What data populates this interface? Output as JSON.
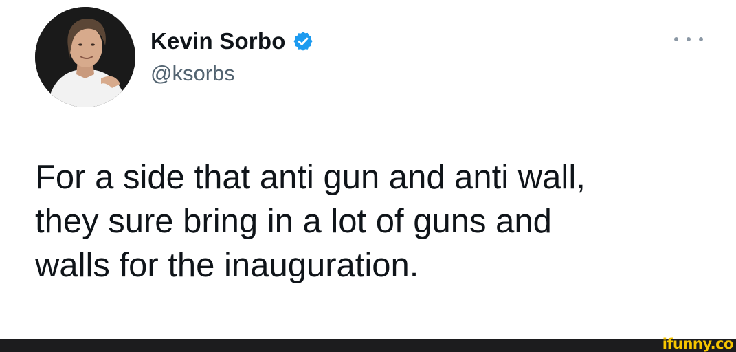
{
  "tweet": {
    "author": {
      "display_name": "Kevin Sorbo",
      "handle": "@ksorbs",
      "verified": true,
      "verified_icon": "verified-badge-icon",
      "avatar_icon": "profile-photo"
    },
    "text_lines": [
      "For a side that anti gun and anti wall,",
      "they sure bring in a lot of guns and",
      "walls for the inauguration."
    ],
    "more_icon": "more-options-icon"
  },
  "watermark": {
    "text": "ifunny.co"
  },
  "colors": {
    "text": "#0f1419",
    "handle": "#536471",
    "verified": "#1d9bf0",
    "watermark": "#f7c600",
    "footer": "#1c1c1e"
  }
}
